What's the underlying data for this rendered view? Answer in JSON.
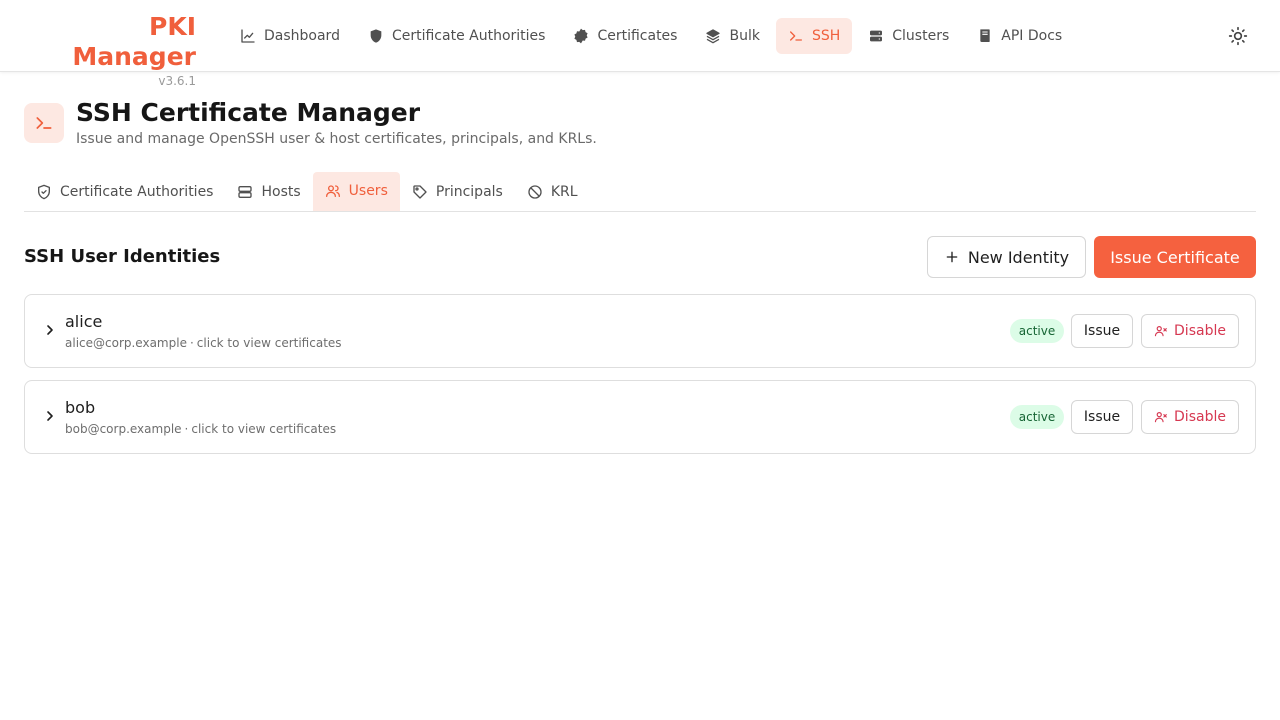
{
  "brand": {
    "title": "PKI Manager",
    "version": "v3.6.1"
  },
  "nav": {
    "items": [
      {
        "label": "Dashboard",
        "icon": "chart-line-icon",
        "active": false
      },
      {
        "label": "Certificate Authorities",
        "icon": "shield-icon",
        "active": false
      },
      {
        "label": "Certificates",
        "icon": "badge-check-icon",
        "active": false
      },
      {
        "label": "Bulk",
        "icon": "layers-icon",
        "active": false
      },
      {
        "label": "SSH",
        "icon": "terminal-icon",
        "active": true
      },
      {
        "label": "Clusters",
        "icon": "server-icon",
        "active": false
      },
      {
        "label": "API Docs",
        "icon": "book-icon",
        "active": false
      }
    ],
    "theme_icon": "sun-icon"
  },
  "page": {
    "icon": "terminal-icon",
    "title": "SSH Certificate Manager",
    "subtitle": "Issue and manage OpenSSH user & host certificates, principals, and KRLs."
  },
  "subtabs": {
    "items": [
      {
        "label": "Certificate Authorities",
        "icon": "shield-check-icon",
        "active": false
      },
      {
        "label": "Hosts",
        "icon": "server-icon",
        "active": false
      },
      {
        "label": "Users",
        "icon": "users-icon",
        "active": true
      },
      {
        "label": "Principals",
        "icon": "tag-icon",
        "active": false
      },
      {
        "label": "KRL",
        "icon": "ban-icon",
        "active": false
      }
    ]
  },
  "section": {
    "title": "SSH User Identities",
    "new_identity_label": "New Identity",
    "issue_certificate_label": "Issue Certificate"
  },
  "identities": [
    {
      "name": "alice",
      "email": "alice@corp.example",
      "hint": "click to view certificates",
      "status": "active",
      "issue_label": "Issue",
      "disable_label": "Disable"
    },
    {
      "name": "bob",
      "email": "bob@corp.example",
      "hint": "click to view certificates",
      "status": "active",
      "issue_label": "Issue",
      "disable_label": "Disable"
    }
  ],
  "colors": {
    "accent": "#f05f3c",
    "accent_soft": "#fde8e2",
    "badge_bg": "#dcfce7",
    "badge_text": "#166534",
    "danger": "#d63851"
  }
}
